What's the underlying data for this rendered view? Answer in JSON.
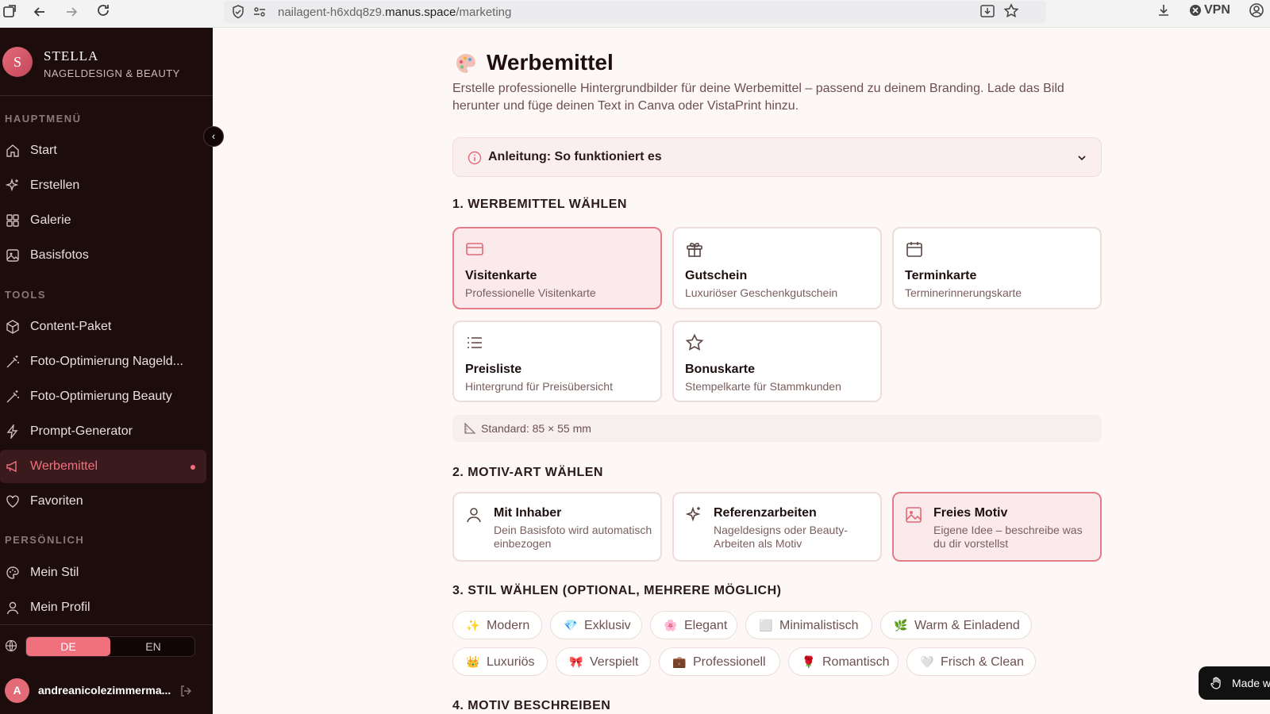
{
  "browser": {
    "url_prefix": "nailagent-h6xdq8z9.",
    "url_domain": "manus.space",
    "url_path": "/marketing",
    "vpn_label": "VPN"
  },
  "sidebar": {
    "logo_letter": "S",
    "brand_name": "STELLA",
    "brand_sub": "NAGELDESIGN & BEAUTY",
    "collapse_glyph": "‹",
    "sections": {
      "main": "HAUPTMENÜ",
      "tools": "TOOLS",
      "personal": "PERSÖNLICH"
    },
    "main_items": [
      {
        "label": "Start",
        "icon": "home-icon"
      },
      {
        "label": "Erstellen",
        "icon": "sparkles-icon"
      },
      {
        "label": "Galerie",
        "icon": "grid-icon"
      },
      {
        "label": "Basisfotos",
        "icon": "image-icon"
      }
    ],
    "tool_items": [
      {
        "label": "Content-Paket",
        "icon": "package-icon"
      },
      {
        "label": "Foto-Optimierung Nageld...",
        "icon": "magic-wand-icon"
      },
      {
        "label": "Foto-Optimierung Beauty",
        "icon": "magic-wand-icon"
      },
      {
        "label": "Prompt-Generator",
        "icon": "lightning-icon"
      },
      {
        "label": "Werbemittel",
        "icon": "megaphone-icon",
        "active": true
      },
      {
        "label": "Favoriten",
        "icon": "heart-icon"
      }
    ],
    "personal_items": [
      {
        "label": "Mein Stil",
        "icon": "palette-icon"
      },
      {
        "label": "Mein Profil",
        "icon": "user-icon"
      }
    ],
    "lang": {
      "de": "DE",
      "en": "EN",
      "active": "DE"
    },
    "user": {
      "avatar_letter": "A",
      "email": "andreanicolezimmerma..."
    }
  },
  "main": {
    "title": "Werbemittel",
    "intro": "Erstelle professionelle Hintergrundbilder für deine Werbemittel – passend zu deinem Branding. Lade das Bild herunter und füge deinen Text in Canva oder VistaPrint hinzu.",
    "accordion_title": "Anleitung: So funktioniert es",
    "step1_title": "1. WERBEMITTEL WÄHLEN",
    "products": [
      {
        "title": "Visitenkarte",
        "sub": "Professionelle Visitenkarte",
        "icon": "card-icon",
        "selected": true
      },
      {
        "title": "Gutschein",
        "sub": "Luxuriöser Geschenkgutschein",
        "icon": "gift-icon",
        "selected": false
      },
      {
        "title": "Terminkarte",
        "sub": "Terminerinnerungskarte",
        "icon": "calendar-icon",
        "selected": false
      },
      {
        "title": "Preisliste",
        "sub": "Hintergrund für Preisübersicht",
        "icon": "list-icon",
        "selected": false
      },
      {
        "title": "Bonuskarte",
        "sub": "Stempelkarte für Stammkunden",
        "icon": "star-icon",
        "selected": false
      }
    ],
    "standard_text": "Standard: 85 × 55 mm",
    "step2_title": "2. MOTIV-ART WÄHLEN",
    "motifs": [
      {
        "title": "Mit Inhaber",
        "sub": "Dein Basisfoto wird automatisch einbezogen",
        "icon": "user-icon",
        "selected": false
      },
      {
        "title": "Referenzarbeiten",
        "sub": "Nageldesigns oder Beauty-Arbeiten als Motiv",
        "icon": "sparkles-icon",
        "selected": false
      },
      {
        "title": "Freies Motiv",
        "sub": "Eigene Idee – beschreibe was du dir vorstellst",
        "icon": "image-icon",
        "selected": true
      }
    ],
    "step3_title": "3. STIL WÄHLEN (OPTIONAL, MEHRERE MÖGLICH)",
    "styles": [
      {
        "emoji": "✨",
        "label": "Modern"
      },
      {
        "emoji": "💎",
        "label": "Exklusiv"
      },
      {
        "emoji": "🌸",
        "label": "Elegant"
      },
      {
        "emoji": "⬜",
        "label": "Minimalistisch"
      },
      {
        "emoji": "🌿",
        "label": "Warm & Einladend"
      },
      {
        "emoji": "👑",
        "label": "Luxuriös"
      },
      {
        "emoji": "🎀",
        "label": "Verspielt"
      },
      {
        "emoji": "💼",
        "label": "Professionell"
      },
      {
        "emoji": "🌹",
        "label": "Romantisch"
      },
      {
        "emoji": "🤍",
        "label": "Frisch & Clean"
      }
    ],
    "step4_title": "4. MOTIV BESCHREIBEN"
  },
  "made_with": "Made w",
  "colors": {
    "accent": "#f0707e",
    "sidebar_bg": "#1c0c0c",
    "selected_border": "#e67c8a"
  }
}
